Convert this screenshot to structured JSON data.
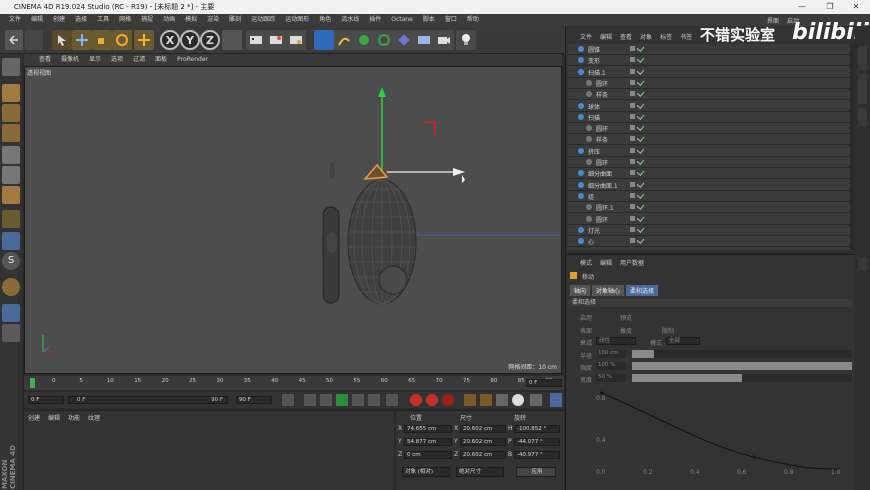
{
  "window": {
    "title": "CINEMA 4D R19.024 Studio (RC - R19) - [未标题 2 *] - 主要",
    "minimize": "—",
    "maximize": "❐",
    "close": "✕"
  },
  "menu": [
    "文件",
    "编辑",
    "创建",
    "选择",
    "工具",
    "网格",
    "捕捉",
    "动画",
    "模拟",
    "渲染",
    "雕刻",
    "运动跟踪",
    "运动图形",
    "角色",
    "流水线",
    "插件",
    "Octane",
    "脚本",
    "窗口",
    "帮助"
  ],
  "menu_right": [
    "界面",
    "启动"
  ],
  "toolbar": {
    "axis_x": "X",
    "axis_y": "Y",
    "axis_z": "Z"
  },
  "viewport": {
    "menu": [
      "查看",
      "摄像机",
      "显示",
      "选项",
      "过滤",
      "面板",
      "ProRender"
    ],
    "label": "透视视图",
    "grid_info": "网格间距：10 cm"
  },
  "timeline": {
    "ticks": [
      "0",
      "5",
      "10",
      "15",
      "20",
      "25",
      "30",
      "35",
      "40",
      "45",
      "50",
      "55",
      "60",
      "65",
      "70",
      "75",
      "80",
      "85",
      "90"
    ],
    "frame_end_field": "0 F",
    "start": "0 F",
    "scrub_start": "0 F",
    "scrub_end": "90 F",
    "end": "90 F",
    "progress": 0.0
  },
  "materials": {
    "menu": [
      "创建",
      "编辑",
      "功能",
      "纹理"
    ]
  },
  "coordinates": {
    "headers": [
      "位置",
      "尺寸",
      "旋转"
    ],
    "rows": [
      {
        "axis": "X",
        "pos": "74.655 cm",
        "size": "20.602 cm",
        "rot_axis": "H",
        "rot": "-100.852 °"
      },
      {
        "axis": "Y",
        "pos": "54.877 cm",
        "size": "20.602 cm",
        "rot_axis": "P",
        "rot": "-44.077 °"
      },
      {
        "axis": "Z",
        "pos": "0 cm",
        "size": "20.602 cm",
        "rot_axis": "B",
        "rot": "-40.977 °"
      }
    ],
    "mode1": "对象 (相对)",
    "mode2": "绝对尺寸",
    "apply": "应用"
  },
  "objects": {
    "menu": [
      "文件",
      "编辑",
      "查看",
      "对象",
      "标签",
      "书签"
    ],
    "items": [
      {
        "label": "圆锥",
        "indent": 0
      },
      {
        "label": "变形",
        "indent": 0
      },
      {
        "label": "扫描.1",
        "indent": 0
      },
      {
        "label": "圆环",
        "indent": 1
      },
      {
        "label": "样条",
        "indent": 1
      },
      {
        "label": "球体",
        "indent": 0
      },
      {
        "label": "扫描",
        "indent": 0
      },
      {
        "label": "圆环",
        "indent": 1
      },
      {
        "label": "样条",
        "indent": 1
      },
      {
        "label": "挤压",
        "indent": 0
      },
      {
        "label": "圆环",
        "indent": 1
      },
      {
        "label": "细分曲面",
        "indent": 0
      },
      {
        "label": "细分曲面.1",
        "indent": 0
      },
      {
        "label": "组",
        "indent": 0
      },
      {
        "label": "圆环.1",
        "indent": 1
      },
      {
        "label": "圆环",
        "indent": 1
      },
      {
        "label": "灯光",
        "indent": 0
      },
      {
        "label": "心",
        "indent": 0
      }
    ]
  },
  "attributes": {
    "menu": [
      "模式",
      "编辑",
      "用户数据"
    ],
    "tool": "移动",
    "tabs": [
      "轴向",
      "对象轴心",
      "柔和选择"
    ],
    "section": "柔和选择",
    "rows": [
      {
        "l1": "启用",
        "l2": "预览"
      },
      {
        "l1": "表面",
        "l2": "橡皮",
        "l3": "限制"
      },
      {
        "l1": "衰减",
        "v1": "线性",
        "l2": "模式",
        "v2": "全部"
      }
    ],
    "sliders": [
      {
        "label": "半径",
        "value": "100 cm",
        "fill": 0.1
      },
      {
        "label": "强度",
        "value": "100 %",
        "fill": 1.0
      },
      {
        "label": "宽度",
        "value": "50 %",
        "fill": 0.5
      }
    ],
    "graph_y": [
      "0.8",
      "0.4"
    ],
    "graph_x": [
      "0.0",
      "0.2",
      "0.4",
      "0.6",
      "0.8",
      "1.0"
    ]
  },
  "watermark": {
    "channel": "不错实验室",
    "site": "bilibili"
  },
  "brand": "MAXON CINEMA 4D"
}
